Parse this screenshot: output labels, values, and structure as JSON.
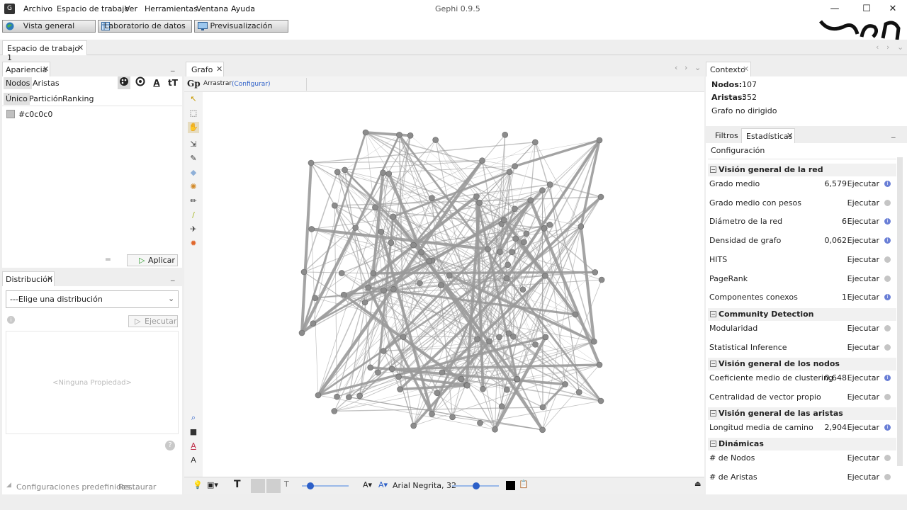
{
  "window": {
    "title": "Gephi 0.9.5",
    "logo": "gephi-logo-icon"
  },
  "menu": [
    "Archivo",
    "Espacio de trabajo",
    "Ver",
    "Herramientas",
    "Ventana",
    "Ayuda"
  ],
  "modes": [
    {
      "label": "Vista general",
      "icon": "globe-icon"
    },
    {
      "label": "Laboratorio de datos",
      "icon": "table-icon"
    },
    {
      "label": "Previsualización",
      "icon": "monitor-icon"
    }
  ],
  "workspace_tab": "Espacio de trabajo 1",
  "apariencia": {
    "title": "Apariencia",
    "tabs": [
      "Nodos",
      "Aristas"
    ],
    "subtabs": [
      "Único",
      "Partición",
      "Ranking"
    ],
    "color_value": "#c0c0c0",
    "color_swatch": "#c0c0c0",
    "apply_label": "Aplicar"
  },
  "distribucion": {
    "title": "Distribución",
    "select_value": "---Elige una distribución",
    "run_label": "Ejecutar",
    "empty_text": "<Ninguna Propiedad>",
    "presets_label": "Configuraciones predefinidas...",
    "restore_label": "Restaurar"
  },
  "grafo": {
    "title": "Grafo",
    "tool_label": "Arrastrar",
    "configure_label": "(Configurar)",
    "font_label": "Arial Negrita, 32"
  },
  "contexto": {
    "title": "Contexto",
    "nodes_label": "Nodos:",
    "nodes_value": "107",
    "edges_label": "Aristas:",
    "edges_value": "352",
    "graph_type": "Grafo no dirigido"
  },
  "statistics": {
    "tabs": [
      "Filtros",
      "Estadísticas"
    ],
    "config_label": "Configuración",
    "run_label": "Ejecutar",
    "categories": [
      {
        "name": "Visión general de la red",
        "items": [
          {
            "name": "Grado medio",
            "value": "6,579",
            "info": "active"
          },
          {
            "name": "Grado medio con pesos",
            "value": "",
            "info": "dim"
          },
          {
            "name": "Diámetro de la red",
            "value": "6",
            "info": "active"
          },
          {
            "name": "Densidad de grafo",
            "value": "0,062",
            "info": "active"
          },
          {
            "name": "HITS",
            "value": "",
            "info": "dim"
          },
          {
            "name": "PageRank",
            "value": "",
            "info": "dim"
          },
          {
            "name": "Componentes conexos",
            "value": "1",
            "info": "active"
          }
        ]
      },
      {
        "name": "Community Detection",
        "items": [
          {
            "name": "Modularidad",
            "value": "",
            "info": "dim"
          },
          {
            "name": "Statistical Inference",
            "value": "",
            "info": "dim"
          }
        ]
      },
      {
        "name": "Visión general de los nodos",
        "items": [
          {
            "name": "Coeficiente medio de clustering",
            "value": "0,648",
            "info": "active"
          },
          {
            "name": "Centralidad de vector propio",
            "value": "",
            "info": "dim"
          }
        ]
      },
      {
        "name": "Visión general de las aristas",
        "items": [
          {
            "name": "Longitud media de camino",
            "value": "2,904",
            "info": "active"
          }
        ]
      },
      {
        "name": "Dinámicas",
        "items": [
          {
            "name": "# de Nodos",
            "value": "",
            "info": "dim"
          },
          {
            "name": "# de Aristas",
            "value": "",
            "info": "dim"
          }
        ]
      }
    ]
  },
  "colors": {
    "node": "#8c8c8c",
    "edge": "#9a9a9a",
    "accent": "#2c5fc8"
  }
}
